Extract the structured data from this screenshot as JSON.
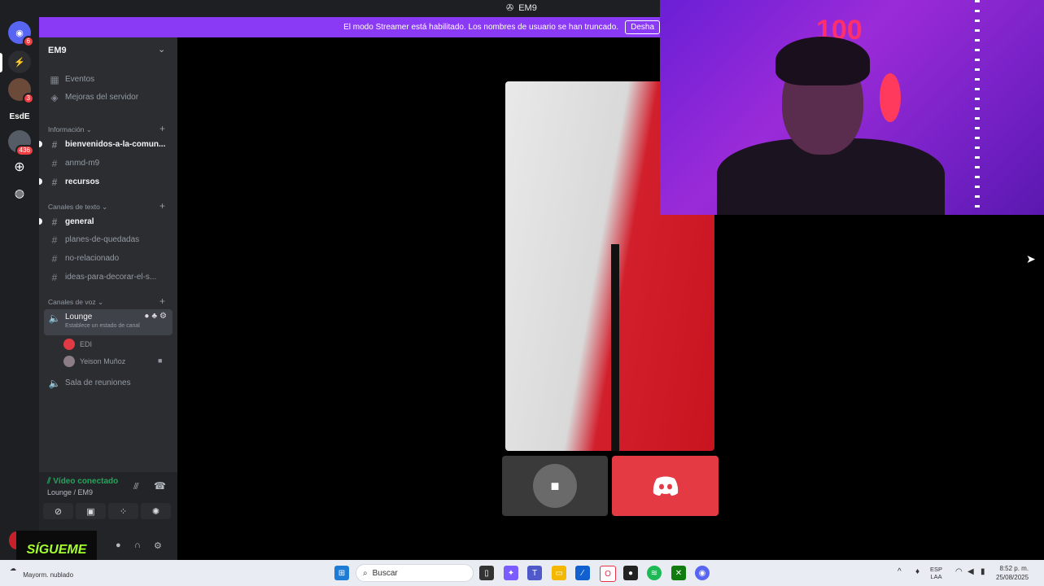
{
  "window": {
    "title": "EM9"
  },
  "banner": {
    "text": "El modo Streamer está habilitado. Los nombres de usuario se han truncado.",
    "button": "Desha"
  },
  "rail": {
    "badges": [
      "6",
      "3",
      "436"
    ],
    "esde_label": "EsdE"
  },
  "sidebar": {
    "server_name": "EM9",
    "top_items": [
      {
        "label": "Eventos",
        "icon": "calendar-icon"
      },
      {
        "label": "Mejoras del servidor",
        "icon": "boost-icon"
      }
    ],
    "categories": {
      "info": "Información",
      "text": "Canales de texto",
      "voice": "Canales de voz"
    },
    "info_channels": [
      {
        "label": "bienvenidos-a-la-comun...",
        "unread": true
      },
      {
        "label": "anmd-m9",
        "unread": false
      },
      {
        "label": "recursos",
        "unread": true
      }
    ],
    "text_channels": [
      {
        "label": "general",
        "unread": true
      },
      {
        "label": "planes-de-quedadas",
        "unread": false
      },
      {
        "label": "no-relacionado",
        "unread": false
      },
      {
        "label": "ideas-para-decorar-el-s...",
        "unread": false
      }
    ],
    "voice_channel": {
      "name": "Lounge",
      "status": "Establece un estado de canal",
      "users": [
        "EDI",
        "Yeison Muñoz"
      ]
    },
    "other_voice": "Sala de reuniones"
  },
  "voice_panel": {
    "status": "Vídeo conectado",
    "location": "Lounge / EM9"
  },
  "overlay": {
    "sigueme": "SÍGUEME"
  },
  "taskbar": {
    "weather": "Mayorm. nublado",
    "search_placeholder": "Buscar",
    "lang_top": "ESP",
    "lang_bottom": "LAA",
    "time": "8:52 p. m.",
    "date": "25/08/2025"
  },
  "colors": {
    "banner": "#8a39f5",
    "discord_tile": "#e33a44",
    "connected": "#23a55a"
  }
}
